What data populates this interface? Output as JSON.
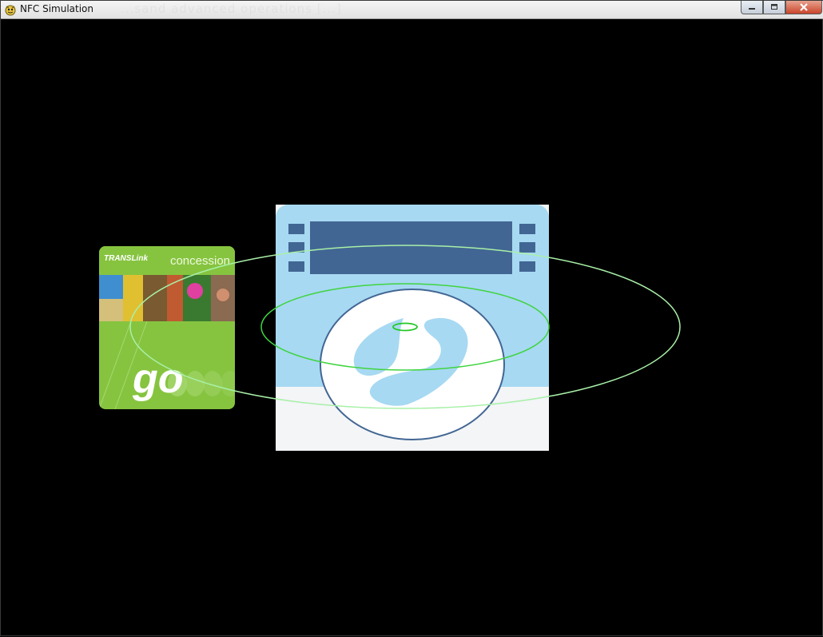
{
  "window": {
    "title": "NFC Simulation",
    "ghost_text": "...sand advanced operations [...]"
  },
  "controls": {
    "minimize": "minimize",
    "maximize": "maximize",
    "close": "close"
  },
  "card": {
    "brand": "TRANSLink",
    "type": "concession",
    "logo_text": "go",
    "color": "#86c440"
  },
  "reader": {
    "panel_color": "#a7d9f2",
    "display_color": "#426693",
    "icon": "translink-reader-icon"
  },
  "field": {
    "ring_colors": [
      "#a8f0a8",
      "#3fd43f",
      "#24c824"
    ]
  }
}
